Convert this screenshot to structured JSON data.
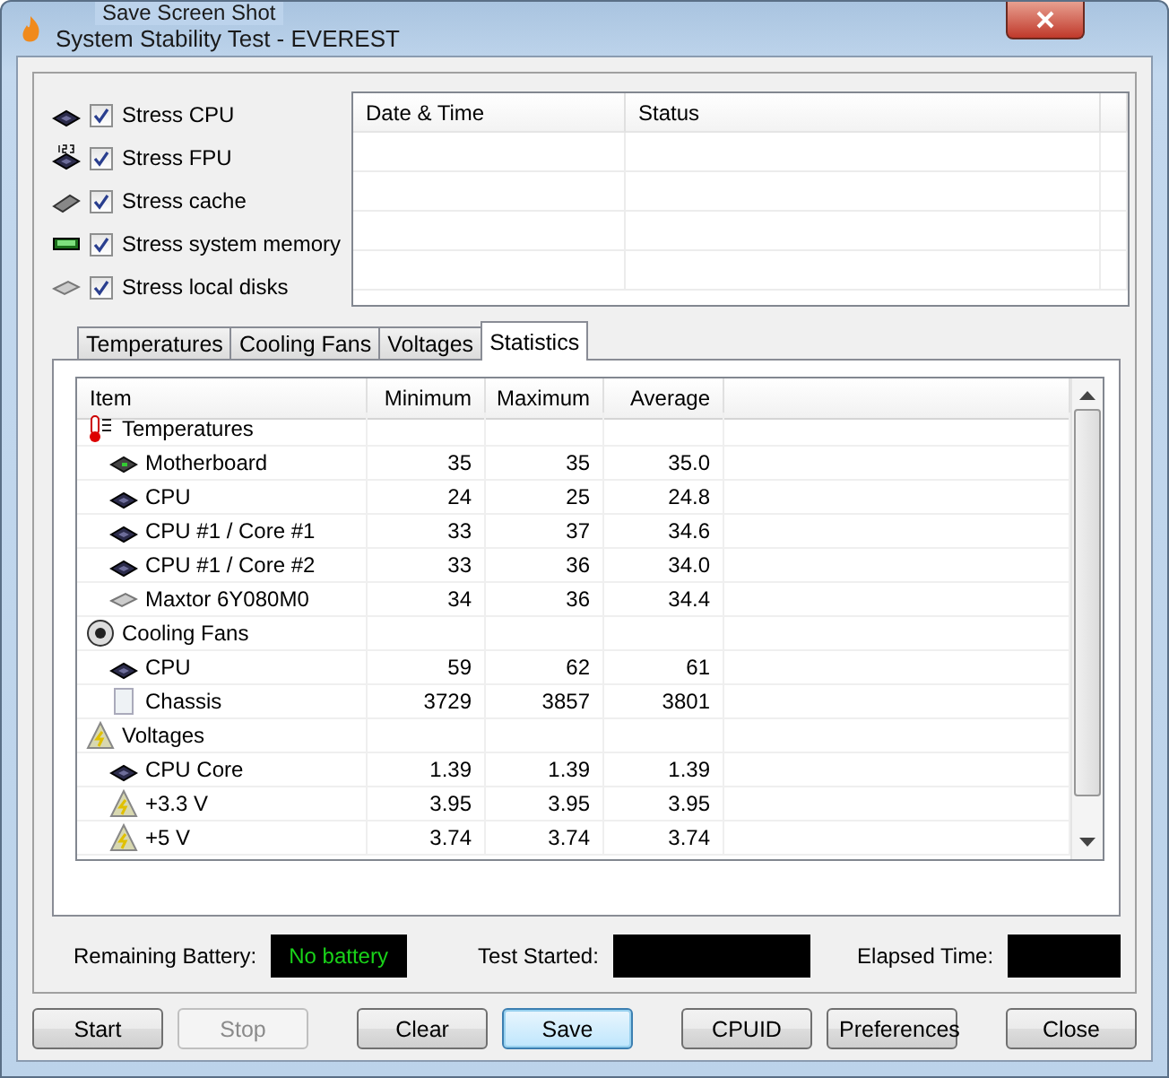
{
  "window": {
    "title": "System Stability Test - EVEREST"
  },
  "overlay_window": {
    "title": "Save Screen Shot"
  },
  "stress_options": [
    {
      "kind": "cpu",
      "label": "Stress CPU",
      "checked": true
    },
    {
      "kind": "fpu",
      "label": "Stress FPU",
      "checked": true
    },
    {
      "kind": "cache",
      "label": "Stress cache",
      "checked": true
    },
    {
      "kind": "memory",
      "label": "Stress system memory",
      "checked": true
    },
    {
      "kind": "disk",
      "label": "Stress local disks",
      "checked": true
    }
  ],
  "log_table": {
    "columns": [
      "Date & Time",
      "Status"
    ]
  },
  "tabs": [
    {
      "label": "Temperatures",
      "selected": false
    },
    {
      "label": "Cooling Fans",
      "selected": false
    },
    {
      "label": "Voltages",
      "selected": false
    },
    {
      "label": "Statistics",
      "selected": true
    }
  ],
  "stats_table": {
    "columns": [
      "Item",
      "Minimum",
      "Maximum",
      "Average"
    ],
    "rows": [
      {
        "kind": "thermometer",
        "group": true,
        "item": "Temperatures"
      },
      {
        "kind": "board",
        "group": false,
        "item": "Motherboard",
        "minimum": "35",
        "maximum": "35",
        "average": "35.0"
      },
      {
        "kind": "chip",
        "group": false,
        "item": "CPU",
        "minimum": "24",
        "maximum": "25",
        "average": "24.8"
      },
      {
        "kind": "chip",
        "group": false,
        "item": "CPU #1 / Core #1",
        "minimum": "33",
        "maximum": "37",
        "average": "34.6"
      },
      {
        "kind": "chip",
        "group": false,
        "item": "CPU #1 / Core #2",
        "minimum": "33",
        "maximum": "36",
        "average": "34.0"
      },
      {
        "kind": "disk",
        "group": false,
        "item": "Maxtor 6Y080M0",
        "minimum": "34",
        "maximum": "36",
        "average": "34.4"
      },
      {
        "kind": "fan",
        "group": true,
        "item": "Cooling Fans"
      },
      {
        "kind": "chip",
        "group": false,
        "item": "CPU",
        "minimum": "59",
        "maximum": "62",
        "average": "61"
      },
      {
        "kind": "case",
        "group": false,
        "item": "Chassis",
        "minimum": "3729",
        "maximum": "3857",
        "average": "3801"
      },
      {
        "kind": "bolt",
        "group": true,
        "item": "Voltages"
      },
      {
        "kind": "chip",
        "group": false,
        "item": "CPU Core",
        "minimum": "1.39",
        "maximum": "1.39",
        "average": "1.39"
      },
      {
        "kind": "bolt",
        "group": false,
        "item": "+3.3 V",
        "minimum": "3.95",
        "maximum": "3.95",
        "average": "3.95"
      },
      {
        "kind": "bolt",
        "group": false,
        "item": "+5 V",
        "minimum": "3.74",
        "maximum": "3.74",
        "average": "3.74"
      }
    ]
  },
  "status": [
    {
      "label": "Remaining Battery:",
      "value": "No battery"
    },
    {
      "label": "Test Started:"
    },
    {
      "label": "Elapsed Time:"
    }
  ],
  "buttons": [
    {
      "label": "Start",
      "disabled": false,
      "focused": false
    },
    {
      "label": "Stop",
      "disabled": true,
      "focused": false
    },
    {
      "label": "Clear",
      "disabled": false,
      "focused": false
    },
    {
      "label": "Save",
      "disabled": false,
      "focused": true
    },
    {
      "label": "CPUID",
      "disabled": false,
      "focused": false
    },
    {
      "label": "Preferences",
      "disabled": false,
      "focused": false
    },
    {
      "label": "Close",
      "disabled": false,
      "focused": false
    }
  ]
}
